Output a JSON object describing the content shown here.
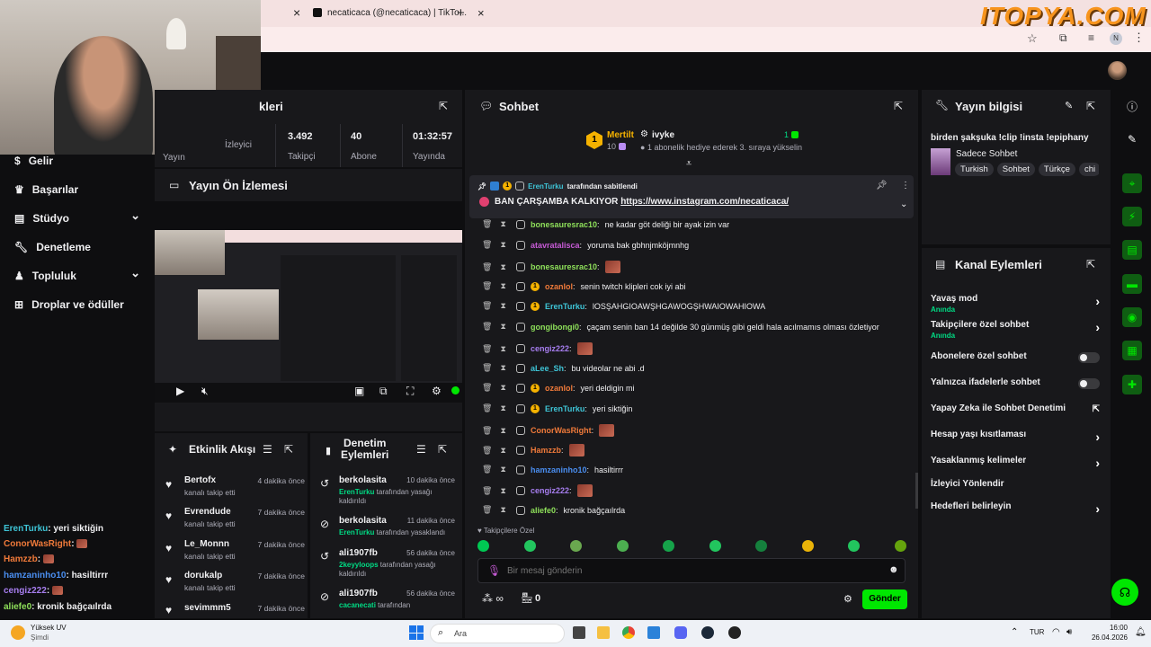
{
  "browser": {
    "tab1_close": "×",
    "tab2_title": "necaticaca (@necaticaca) | TikTo...",
    "tab2_close": "×",
    "new_tab": "+",
    "watermark": "ITOPYA.COM",
    "profile_letter": "N"
  },
  "sidebar": {
    "items": [
      {
        "label": "Gelir",
        "icon": "dollar-icon"
      },
      {
        "label": "Başarılar",
        "icon": "trophy-icon"
      },
      {
        "label": "Stüdyo",
        "icon": "studio-icon",
        "chevron": "⌄"
      },
      {
        "label": "Denetleme",
        "icon": "wrench-icon"
      },
      {
        "label": "Topluluk",
        "icon": "community-icon",
        "chevron": "⌄"
      },
      {
        "label": "Droplar ve ödüller",
        "icon": "drops-icon"
      }
    ]
  },
  "stats": {
    "title": "kleri",
    "items": [
      {
        "value": "",
        "label": "Yayın"
      },
      {
        "value": "",
        "label": "İzleyici"
      },
      {
        "value": "3.492",
        "label": "Takipçi"
      },
      {
        "value": "40",
        "label": "Abone"
      },
      {
        "value": "01:32:57",
        "label": "Yayında"
      }
    ]
  },
  "preview": {
    "title": "Yayın Ön İzlemesi"
  },
  "activity": {
    "title": "Etkinlik Akışı",
    "items": [
      {
        "name": "Bertofx",
        "sub": "kanalı takip etti",
        "time": "4 dakika önce"
      },
      {
        "name": "Evrendude",
        "sub": "kanalı takip etti",
        "time": "7 dakika önce"
      },
      {
        "name": "Le_Monnn",
        "sub": "kanalı takip etti",
        "time": "7 dakika önce"
      },
      {
        "name": "dorukalp",
        "sub": "kanalı takip etti",
        "time": "7 dakika önce"
      },
      {
        "name": "sevimmm5",
        "sub": "",
        "time": "7 dakika önce"
      }
    ]
  },
  "moderation": {
    "title_line1": "Denetim",
    "title_line2": "Eylemleri",
    "items": [
      {
        "name": "berkolasita",
        "actor": "ErenTurku",
        "sub": " tarafından yasağı kaldırıldı",
        "time": "10 dakika önce"
      },
      {
        "name": "berkolasita",
        "actor": "ErenTurku",
        "sub": " tarafından yasaklandı",
        "time": "11 dakika önce"
      },
      {
        "name": "ali1907fb",
        "actor": "2keyyloops",
        "sub": " tarafından yasağı kaldırıldı",
        "time": "56 dakika önce"
      },
      {
        "name": "ali1907fb",
        "actor": "cacanecati",
        "sub": " tarafından",
        "time": "56 dakika önce"
      }
    ]
  },
  "chat": {
    "title": "Sohbet",
    "top_gifter": {
      "rank": "1",
      "name": "Mertilt",
      "count": "10"
    },
    "gift_event": {
      "name": "ivyke",
      "count": "1",
      "text": "1 abonelik hediye ederek 3. sıraya yükselin"
    },
    "pinned": {
      "by": "ErenTurku",
      "by_suffix": " tarafından sabitlendi",
      "message": "BAN ÇARŞAMBA KALKIYOR ",
      "link": "https://www.instagram.com/necaticaca/"
    },
    "messages": [
      {
        "user": "bonesauresrac10",
        "color": "#8ee05a",
        "text": "ne kadar göt deliği bir ayak izin var",
        "emote": false
      },
      {
        "user": "atavratalisca",
        "color": "#c75bd6",
        "text": "yoruma bak gbhnjmköjmnhg",
        "emote": false
      },
      {
        "user": "bonesauresrac10",
        "color": "#8ee05a",
        "text": "",
        "emote": true
      },
      {
        "user": "ozanlol",
        "color": "#f07a3a",
        "text": "senin twitch klipleri cok iyi abi",
        "emote": false,
        "badge": true
      },
      {
        "user": "ErenTurku",
        "color": "#3ec4d6",
        "text": "lOSŞAHGIOAWŞHGAWOGŞHWAIOWAHIOWA",
        "emote": false,
        "badge": true
      },
      {
        "user": "gongibongi0",
        "color": "#8ee05a",
        "text": "çaçam senin ban 14 değilde 30 günmüş gibi geldi hala acılmamıs olması özletiyor",
        "emote": false
      },
      {
        "user": "cengiz222",
        "color": "#a77ef0",
        "text": "",
        "emote": true
      },
      {
        "user": "aLee_Sh",
        "color": "#3ec4d6",
        "text": "bu videolar ne abi .d",
        "emote": false
      },
      {
        "user": "ozanlol",
        "color": "#f07a3a",
        "text": "yeri deldigin mi",
        "emote": false,
        "badge": true
      },
      {
        "user": "ErenTurku",
        "color": "#3ec4d6",
        "text": "yeri siktiğin",
        "emote": false,
        "badge": true
      },
      {
        "user": "ConorWasRight",
        "color": "#f07a3a",
        "text": "",
        "emote": true
      },
      {
        "user": "Hamzzb",
        "color": "#f07a3a",
        "text": "",
        "emote": true
      },
      {
        "user": "hamzaninho10",
        "color": "#4a8ef0",
        "text": "hasiltirrr",
        "emote": false
      },
      {
        "user": "cengiz222",
        "color": "#a77ef0",
        "text": "",
        "emote": true
      },
      {
        "user": "aliefe0",
        "color": "#8ee05a",
        "text": "kronik bağçaılrda",
        "emote": false
      }
    ],
    "followers_only_label": "Takipçilere Özel",
    "input_placeholder": "Bir mesaj gönderin",
    "points": "0",
    "send_label": "Gönder"
  },
  "stream_info": {
    "title_label": "Yayın bilgisi",
    "stream_title": "birden şakşuka !clip !insta !epiphany",
    "category": "Sadece Sohbet",
    "tags": [
      "Turkish",
      "Sohbet",
      "Türkçe",
      "chi"
    ]
  },
  "channel_actions": {
    "title": "Kanal Eylemleri",
    "rows": [
      {
        "label": "Yavaş mod",
        "sub": "Anında",
        "control": "chevron"
      },
      {
        "label": "Takipçilere özel sohbet",
        "sub": "Anında",
        "control": "chevron"
      },
      {
        "label": "Abonelere özel sohbet",
        "sub": "",
        "control": "toggle"
      },
      {
        "label": "Yalnızca ifadelerle sohbet",
        "sub": "",
        "control": "toggle"
      },
      {
        "label": "Yapay Zeka ile Sohbet Denetimi",
        "sub": "",
        "control": "external"
      },
      {
        "label": "Hesap yaşı kısıtlaması",
        "sub": "",
        "control": "chevron"
      },
      {
        "label": "Yasaklanmış kelimeler",
        "sub": "",
        "control": "chevron"
      },
      {
        "label": "İzleyici Yönlendir",
        "sub": "",
        "control": "none"
      },
      {
        "label": "Hedefleri belirleyin",
        "sub": "",
        "control": "chevron"
      }
    ]
  },
  "overlay_chat": [
    {
      "user": "ErenTurku",
      "color": "#3ec4d6",
      "text": "yeri siktiğin",
      "emote": false
    },
    {
      "user": "ConorWasRight",
      "color": "#f07a3a",
      "text": "",
      "emote": true
    },
    {
      "user": "Hamzzb",
      "color": "#f07a3a",
      "text": "",
      "emote": true
    },
    {
      "user": "hamzaninho10",
      "color": "#4a8ef0",
      "text": "hasiltirrr",
      "emote": false
    },
    {
      "user": "cengiz222",
      "color": "#a77ef0",
      "text": "",
      "emote": true
    },
    {
      "user": "aliefe0",
      "color": "#8ee05a",
      "text": "kronik bağçaılrda",
      "emote": false
    }
  ],
  "taskbar": {
    "weather_label": "Yüksek UV",
    "weather_sub": "Şimdi",
    "search_label": "Ara",
    "lang": "TUR",
    "time": "16:00",
    "date": "26.04.2026"
  },
  "colors": {
    "accent": "#00e701",
    "bg": "#0e0e10",
    "panel": "#18181b"
  }
}
